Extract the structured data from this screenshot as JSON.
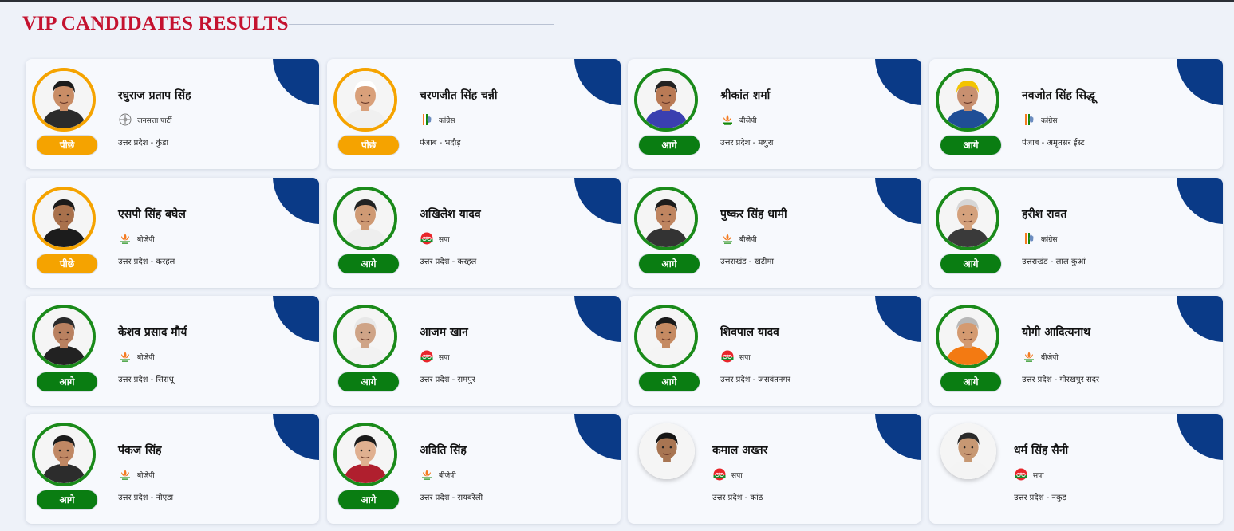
{
  "section": {
    "title": "VIP CANDIDATES RESULTS"
  },
  "colors": {
    "leading": "#0a7d12",
    "trailing": "#f5a300",
    "title": "#c4122f",
    "corner": "#0a3a87"
  },
  "candidates": [
    {
      "name": "रघुराज प्रताप सिंह",
      "party": "जनसत्ता पार्टी",
      "party_icon": "jansatta-symbol-icon",
      "place": "उत्तर प्रदेश - कुंडा",
      "status": "पीछे",
      "state": "trailing"
    },
    {
      "name": "चरणजीत सिंह चन्नी",
      "party": "कांग्रेस",
      "party_icon": "congress-hand-icon",
      "place": "पंजाब - भदौड़",
      "status": "पीछे",
      "state": "trailing"
    },
    {
      "name": "श्रीकांत शर्मा",
      "party": "बीजेपी",
      "party_icon": "bjp-lotus-icon",
      "place": "उत्तर प्रदेश - मथुरा",
      "status": "आगे",
      "state": "leading"
    },
    {
      "name": "नवजोत सिंह सिद्धू",
      "party": "कांग्रेस",
      "party_icon": "congress-hand-icon",
      "place": "पंजाब - अमृतसर ईस्ट",
      "status": "आगे",
      "state": "leading"
    },
    {
      "name": "एसपी सिंह बघेल",
      "party": "बीजेपी",
      "party_icon": "bjp-lotus-icon",
      "place": "उत्तर प्रदेश - करहल",
      "status": "पीछे",
      "state": "trailing"
    },
    {
      "name": "अखिलेश यादव",
      "party": "सपा",
      "party_icon": "sp-cycle-icon",
      "place": "उत्तर प्रदेश - करहल",
      "status": "आगे",
      "state": "leading"
    },
    {
      "name": "पुष्कर सिंह धामी",
      "party": "बीजेपी",
      "party_icon": "bjp-lotus-icon",
      "place": "उत्तराखंड - खटीमा",
      "status": "आगे",
      "state": "leading"
    },
    {
      "name": "हरीश रावत",
      "party": "कांग्रेस",
      "party_icon": "congress-hand-icon",
      "place": "उत्तराखंड - लाल कुआं",
      "status": "आगे",
      "state": "leading"
    },
    {
      "name": "केशव प्रसाद मौर्य",
      "party": "बीजेपी",
      "party_icon": "bjp-lotus-icon",
      "place": "उत्तर प्रदेश - सिराथू",
      "status": "आगे",
      "state": "leading"
    },
    {
      "name": "आजम खान",
      "party": "सपा",
      "party_icon": "sp-cycle-icon",
      "place": "उत्तर प्रदेश - रामपुर",
      "status": "आगे",
      "state": "leading"
    },
    {
      "name": "शिवपाल यादव",
      "party": "सपा",
      "party_icon": "sp-cycle-icon",
      "place": "उत्तर प्रदेश - जसवंतनगर",
      "status": "आगे",
      "state": "leading"
    },
    {
      "name": "योगी आदित्यनाथ",
      "party": "बीजेपी",
      "party_icon": "bjp-lotus-icon",
      "place": "उत्तर प्रदेश - गोरखपुर सदर",
      "status": "आगे",
      "state": "leading"
    },
    {
      "name": "पंकज सिंह",
      "party": "बीजेपी",
      "party_icon": "bjp-lotus-icon",
      "place": "उत्तर प्रदेश - नोएडा",
      "status": "आगे",
      "state": "leading"
    },
    {
      "name": "अदिति सिंह",
      "party": "बीजेपी",
      "party_icon": "bjp-lotus-icon",
      "place": "उत्तर प्रदेश - रायबरेली",
      "status": "आगे",
      "state": "leading"
    },
    {
      "name": "कमाल अख्तर",
      "party": "सपा",
      "party_icon": "sp-cycle-icon",
      "place": "उत्तर प्रदेश - कांठ",
      "status": "",
      "state": "none"
    },
    {
      "name": "धर्म सिंह सैनी",
      "party": "सपा",
      "party_icon": "sp-cycle-icon",
      "place": "उत्तर प्रदेश - नकुड़",
      "status": "",
      "state": "none"
    }
  ]
}
